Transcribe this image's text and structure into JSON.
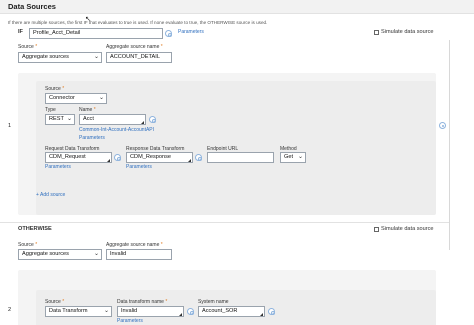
{
  "header": {
    "title": "Data Sources",
    "hint": "If there are multiple sources, the first IF that evaluates to true is used. If none evaluate to true, the OTHERWISE source is used."
  },
  "if_block": {
    "keyword": "IF",
    "condition_value": "Profile_Acct_Detail",
    "parameters_link": "Parameters",
    "simulate_label": "Simulate data source",
    "source_label": "Source",
    "source_value": "Aggregate sources",
    "agg_name_label": "Aggregate source name",
    "agg_name_value": "ACCOUNT_DETAIL",
    "row_number": "1",
    "row": {
      "source_label": "Source",
      "source_value": "Connector",
      "type_label": "Type",
      "type_value": "REST",
      "name_label": "Name",
      "name_value": "Acct",
      "name_link": "Common-Int-Account-AccountAPI",
      "name_params_link": "Parameters",
      "req_transform_label": "Request Data Transform",
      "req_transform_value": "CDM_Request",
      "req_params_link": "Parameters",
      "resp_transform_label": "Response Data Transform",
      "resp_transform_value": "CDM_Response",
      "resp_params_link": "Parameters",
      "endpoint_label": "Endpoint URL",
      "endpoint_value": "",
      "method_label": "Method",
      "method_value": "Get"
    },
    "add_source_link": "+ Add source"
  },
  "otherwise_block": {
    "keyword": "OTHERWISE",
    "simulate_label": "Simulate data source",
    "source_label": "Source",
    "source_value": "Aggregate sources",
    "agg_name_label": "Aggregate source name",
    "agg_name_value": "Invalid",
    "row_number": "2",
    "row": {
      "source_label": "Source",
      "source_value": "Data Transform",
      "dt_name_label": "Data transform name",
      "dt_name_value": "Invalid",
      "dt_params_link": "Parameters",
      "system_label": "System name",
      "system_value": "Account_SOR"
    }
  },
  "icons": {
    "chevron": "chevron-down-icon",
    "gear": "gear-icon",
    "cursor": "mouse-cursor-icon"
  }
}
